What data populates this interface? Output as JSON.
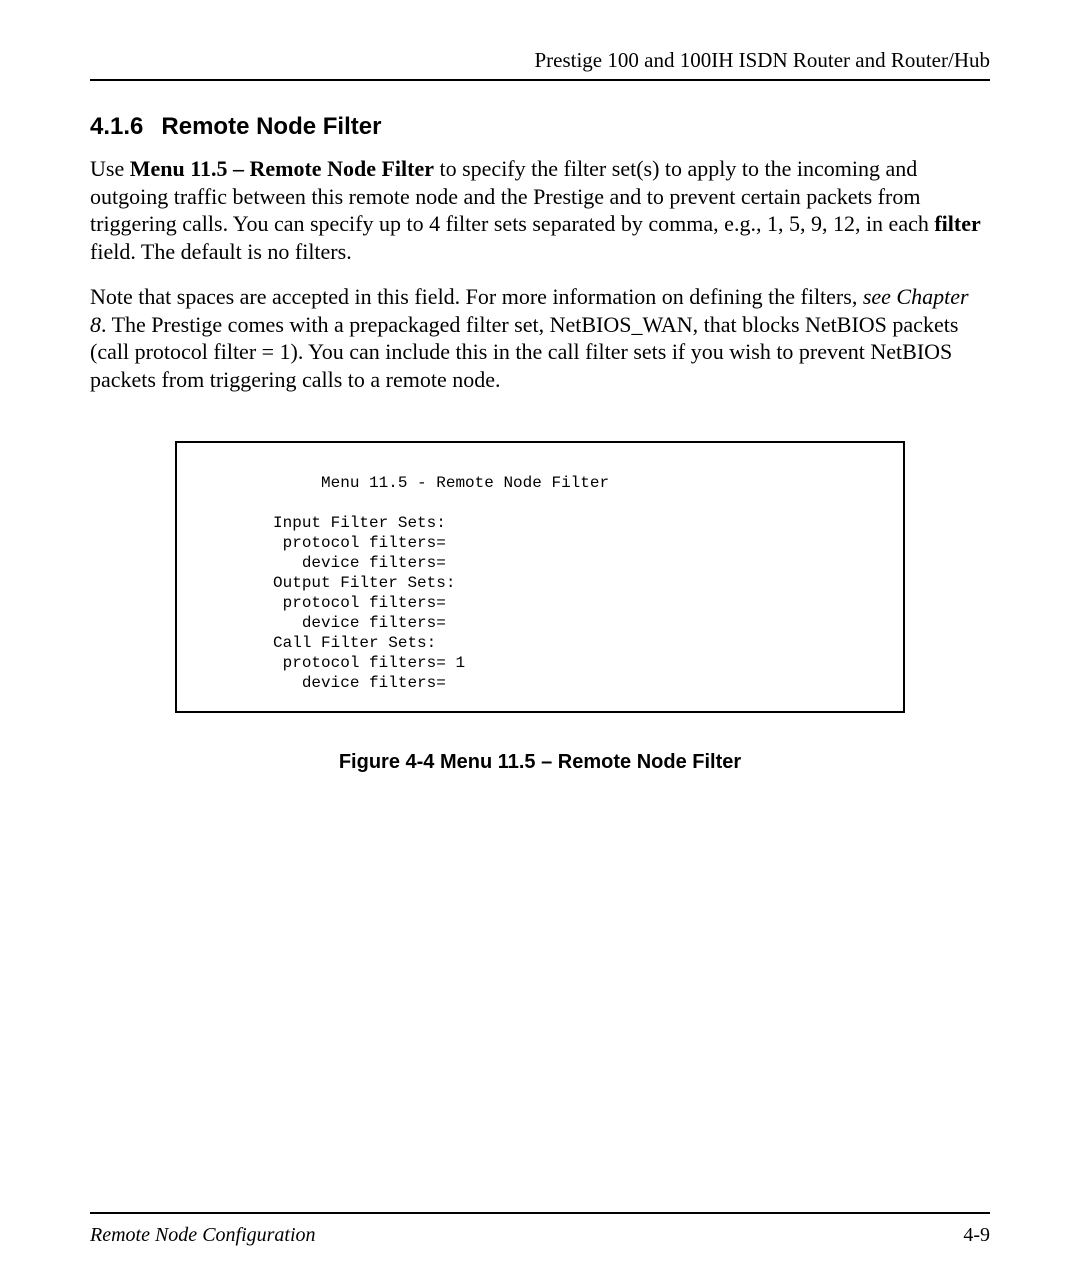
{
  "header": {
    "running_title": "Prestige 100 and 100IH ISDN Router and Router/Hub"
  },
  "section": {
    "number": "4.1.6",
    "title": "Remote Node Filter"
  },
  "para1": {
    "lead": "Use ",
    "menu_ref": "Menu 11.5 – Remote Node Filter",
    "after_menu": " to specify the filter set(s) to apply to the incoming and outgoing traffic between this remote node and the Prestige and to prevent certain packets from triggering calls. You can specify up to 4 filter sets separated by comma, e.g., 1, 5, 9, 12, in each ",
    "filter_word": "filter",
    "tail": " field. The default is no filters."
  },
  "para2": {
    "part1": "Note that spaces are accepted in this field.  For more information on defining the filters, ",
    "see_ref": "see Chapter 8",
    "part2": ".  The Prestige comes with a prepackaged filter set, NetBIOS_WAN, that blocks NetBIOS packets (call protocol filter = 1).  You can include this in the call filter sets if you wish to prevent NetBIOS packets from triggering calls to a remote node."
  },
  "figure": {
    "title_line": "               Menu 11.5 - Remote Node Filter",
    "input_header": "          Input Filter Sets:",
    "input_protocol": "           protocol filters=",
    "input_device": "             device filters=",
    "output_header": "          Output Filter Sets:",
    "output_protocol": "           protocol filters=",
    "output_device": "             device filters=",
    "call_header": "          Call Filter Sets:",
    "call_protocol": "           protocol filters= 1",
    "call_device": "             device filters=",
    "caption": "Figure 4-4 Menu 11.5 – Remote Node Filter"
  },
  "footer": {
    "left": "Remote Node Configuration",
    "right": "4-9"
  }
}
